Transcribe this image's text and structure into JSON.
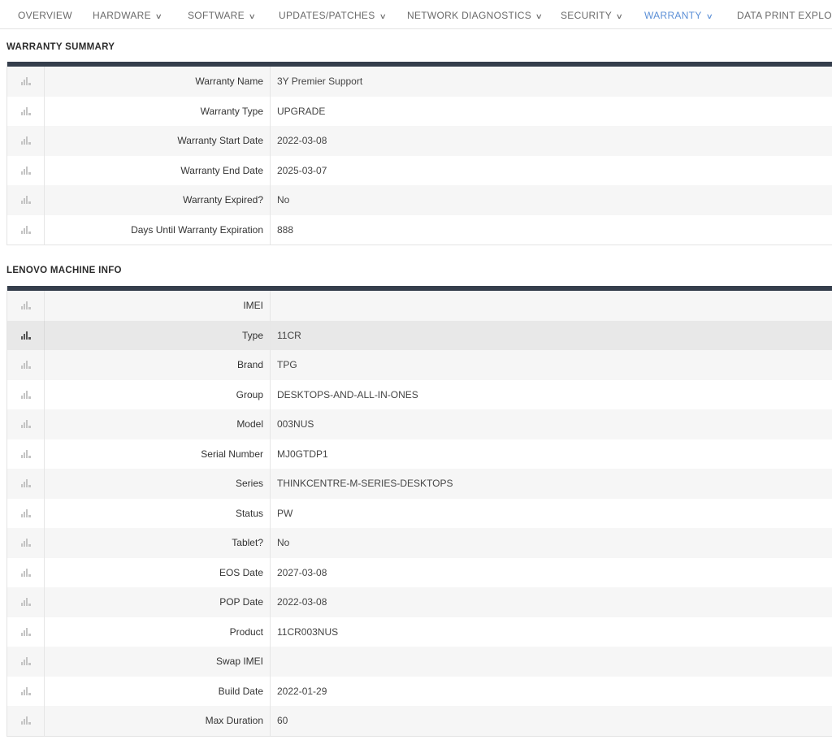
{
  "nav": {
    "tabs": [
      {
        "label": "Overview",
        "dropdown": false,
        "active": false
      },
      {
        "label": "Hardware",
        "dropdown": true,
        "active": false
      },
      {
        "label": "Software",
        "dropdown": true,
        "active": false
      },
      {
        "label": "Updates/Patches",
        "dropdown": true,
        "active": false
      },
      {
        "label": "Network Diagnostics",
        "dropdown": true,
        "active": false
      },
      {
        "label": "Security",
        "dropdown": true,
        "active": false
      },
      {
        "label": "Warranty",
        "dropdown": true,
        "active": true
      },
      {
        "label": "Data Print Explor",
        "dropdown": false,
        "active": false
      }
    ],
    "chevron": "chevron-down-icon"
  },
  "warranty_summary": {
    "title": "Warranty Summary",
    "rows": [
      {
        "label": "Warranty Name",
        "value": "3Y Premier Support"
      },
      {
        "label": "Warranty Type",
        "value": "UPGRADE"
      },
      {
        "label": "Warranty Start Date",
        "value": "2022-03-08"
      },
      {
        "label": "Warranty End Date",
        "value": "2025-03-07"
      },
      {
        "label": "Warranty Expired?",
        "value": "No"
      },
      {
        "label": "Days Until Warranty Expiration",
        "value": "888"
      }
    ]
  },
  "machine_info": {
    "title": "Lenovo Machine Info",
    "rows": [
      {
        "label": "IMEI",
        "value": ""
      },
      {
        "label": "Type",
        "value": "11CR"
      },
      {
        "label": "Brand",
        "value": "TPG"
      },
      {
        "label": "Group",
        "value": "DESKTOPS-AND-ALL-IN-ONES"
      },
      {
        "label": "Model",
        "value": "003NUS"
      },
      {
        "label": "Serial Number",
        "value": "MJ0GTDP1"
      },
      {
        "label": "Series",
        "value": "THINKCENTRE-M-SERIES-DESKTOPS"
      },
      {
        "label": "Status",
        "value": "PW"
      },
      {
        "label": "Tablet?",
        "value": "No"
      },
      {
        "label": "EOS Date",
        "value": "2027-03-08"
      },
      {
        "label": "POP Date",
        "value": "2022-03-08"
      },
      {
        "label": "Product",
        "value": "11CR003NUS"
      },
      {
        "label": "Swap IMEI",
        "value": ""
      },
      {
        "label": "Build Date",
        "value": "2022-01-29"
      },
      {
        "label": "Max Duration",
        "value": "60"
      }
    ]
  },
  "icons": {
    "row_icon": "bar-chart-icon"
  },
  "colors": {
    "accent": "#5b8fd6",
    "header_bar": "#353e4c",
    "highlight_row": "#e8e8e8"
  }
}
